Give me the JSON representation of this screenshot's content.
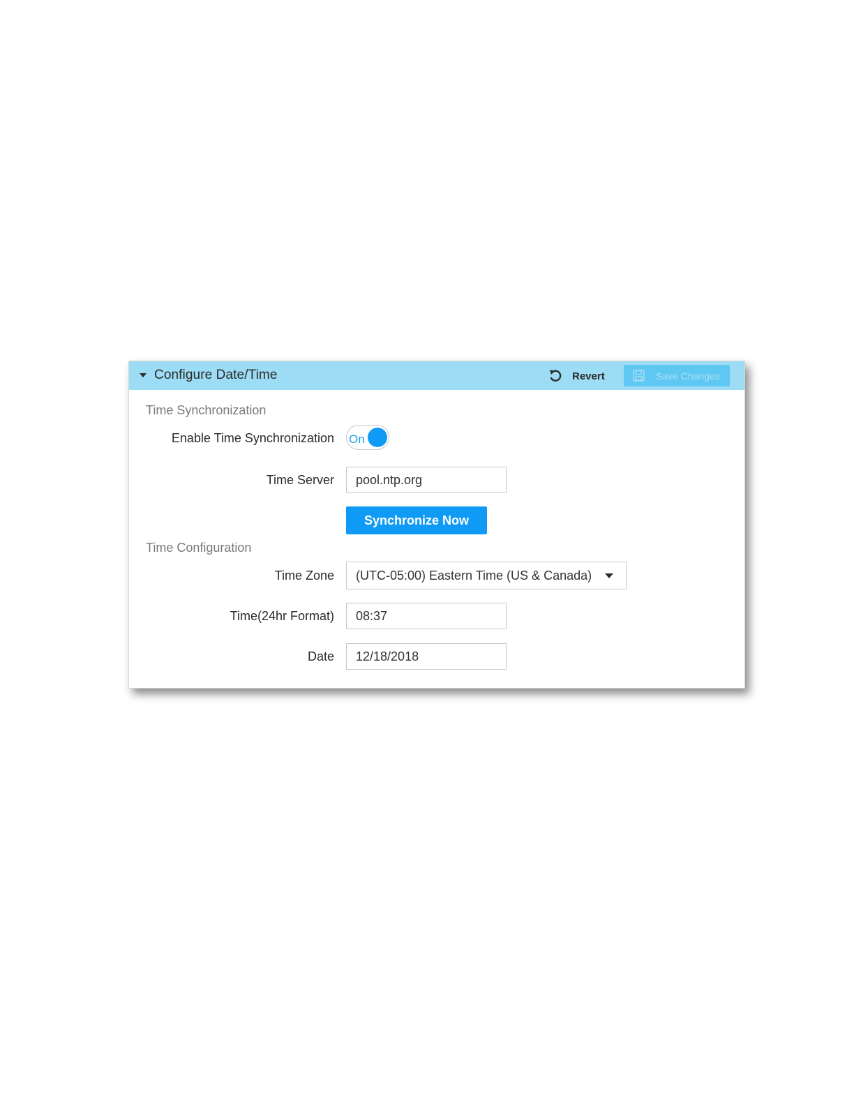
{
  "panel": {
    "title": "Configure Date/Time",
    "revert_label": "Revert",
    "save_label": "Save Changes"
  },
  "time_sync": {
    "section_title": "Time Synchronization",
    "enable_label": "Enable Time Synchronization",
    "toggle_state": "On",
    "server_label": "Time Server",
    "server_value": "pool.ntp.org",
    "sync_button_label": "Synchronize Now"
  },
  "time_config": {
    "section_title": "Time Configuration",
    "timezone_label": "Time Zone",
    "timezone_value": "(UTC-05:00) Eastern Time (US & Canada)",
    "time_label": "Time(24hr Format)",
    "time_value": "08:37",
    "date_label": "Date",
    "date_value": "12/18/2018"
  },
  "colors": {
    "header_bg": "#9cdcf4",
    "accent": "#0f9bf5",
    "save_disabled_bg": "#5ec8f2"
  },
  "icons": {
    "collapse": "triangle-down-icon",
    "revert": "undo-icon",
    "save": "floppy-disk-icon",
    "select_caret": "caret-down-icon"
  }
}
